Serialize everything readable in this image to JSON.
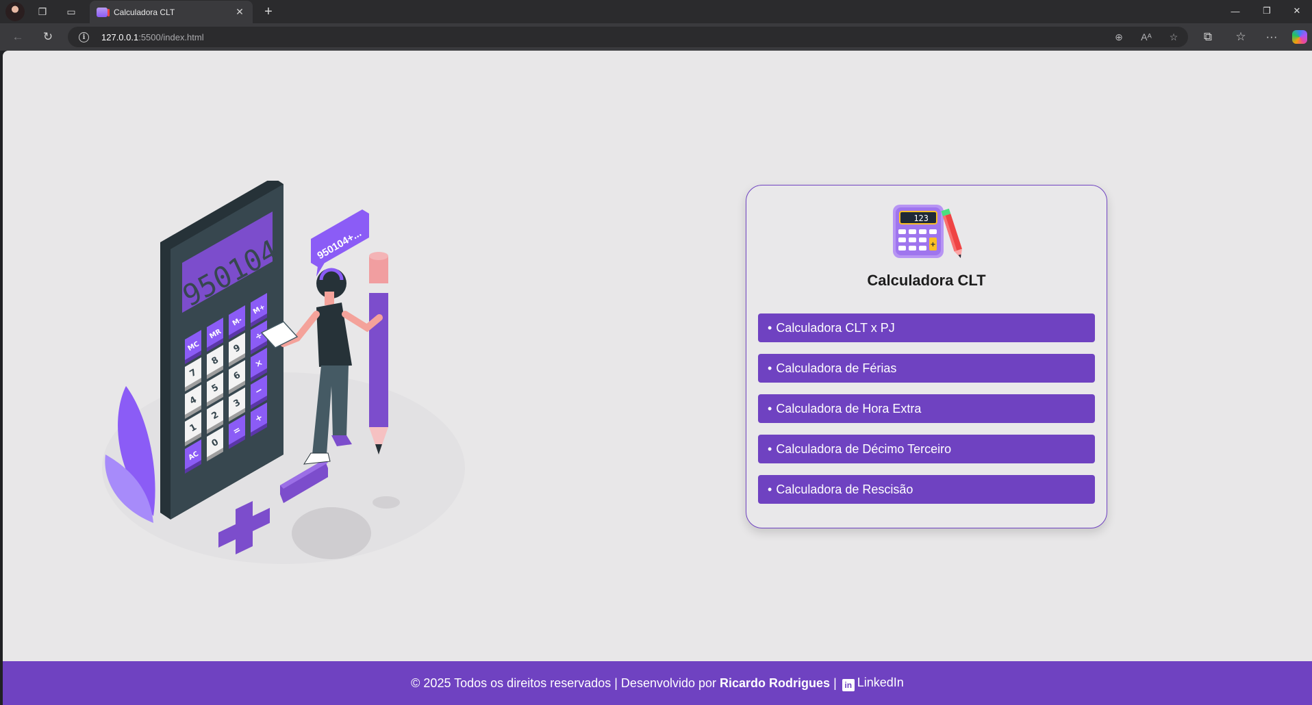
{
  "browser": {
    "tab_title": "Calculadora CLT",
    "url_host": "127.0.0.1",
    "url_path": ":5500/index.html"
  },
  "page": {
    "card_title": "Calculadora CLT",
    "menu": [
      {
        "label": "Calculadora CLT x PJ"
      },
      {
        "label": "Calculadora de Férias"
      },
      {
        "label": "Calculadora de Hora Extra"
      },
      {
        "label": "Calculadora de Décimo Terceiro"
      },
      {
        "label": "Calculadora de Rescisão"
      }
    ],
    "bullet": "•",
    "logo_display": "123"
  },
  "illustration": {
    "display_number": "950104",
    "bubble_text": "950104+...",
    "keys": [
      "MC",
      "MR",
      "M-",
      "M+",
      "7",
      "8",
      "9",
      "÷",
      "4",
      "5",
      "6",
      "×",
      "1",
      "2",
      "3",
      "−",
      "AC",
      "0",
      "=",
      "+"
    ]
  },
  "footer": {
    "text": "© 2025 Todos os direitos reservados | Desenvolvido por",
    "author": "Ricardo Rodrigues",
    "separator": "|",
    "linkedin_label": "LinkedIn",
    "linkedin_icon_text": "in"
  },
  "colors": {
    "accent": "#6f42c1",
    "background": "#e8e7e8",
    "calc_body": "#37474f"
  }
}
